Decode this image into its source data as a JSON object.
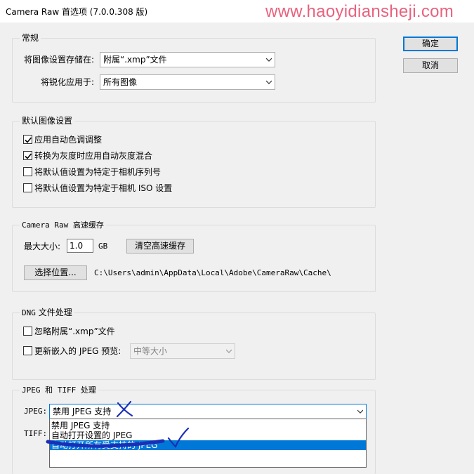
{
  "window": {
    "title": "Camera Raw 首选项 (7.0.0.308 版)",
    "watermark": "www.haoyidiansheji.com"
  },
  "buttons": {
    "ok": "确定",
    "cancel": "取消"
  },
  "general": {
    "legend": "常规",
    "save_label": "将图像设置存储在:",
    "save_value": "附属“.xmp”文件",
    "sharpen_label": "将锐化应用于:",
    "sharpen_value": "所有图像"
  },
  "default_settings": {
    "legend": "默认图像设置",
    "items": [
      {
        "label": "应用自动色调调整",
        "checked": true
      },
      {
        "label": "转换为灰度时应用自动灰度混合",
        "checked": true
      },
      {
        "label": "将默认值设置为特定于相机序列号",
        "checked": false
      },
      {
        "label": "将默认值设置为特定于相机 ISO 设置",
        "checked": false
      }
    ]
  },
  "cache": {
    "legend": "Camera Raw 高速缓存",
    "max_size_label": "最大大小:",
    "max_size_value": "1.0",
    "unit": "GB",
    "purge_button": "清空高速缓存",
    "location_button": "选择位置...",
    "path": "C:\\Users\\admin\\AppData\\Local\\Adobe\\CameraRaw\\Cache\\"
  },
  "dng": {
    "legend": "DNG 文件处理",
    "ignore_label": "忽略附属“.xmp”文件",
    "ignore_checked": false,
    "update_label": "更新嵌入的 JPEG 预览:",
    "update_checked": false,
    "preview_value": "中等大小"
  },
  "jpeg_tiff": {
    "legend": "JPEG 和 TIFF 处理",
    "jpeg_label": "JPEG:",
    "jpeg_value": "禁用 JPEG 支持",
    "tiff_label": "TIFF:",
    "options": [
      "禁用 JPEG 支持",
      "自动打开设置的 JPEG",
      "自动打开所有受支持的 JPEG"
    ],
    "selected_index": 2
  },
  "colors": {
    "accent": "#0078d7",
    "watermark": "#e8627d",
    "annotation": "#1a2fb8"
  }
}
